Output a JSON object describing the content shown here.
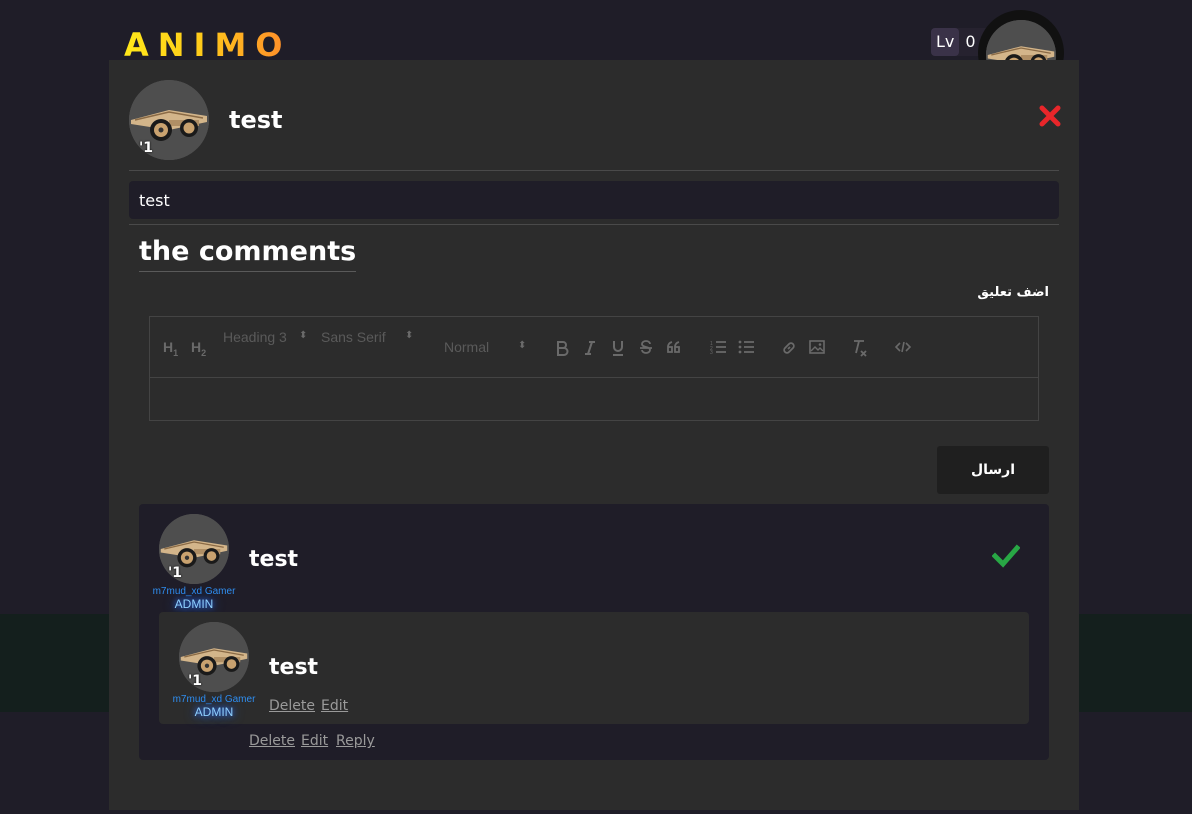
{
  "header": {
    "logo": "ANIMO",
    "level_label": "Lv",
    "level_value": "0"
  },
  "post": {
    "title": "test",
    "avatar_badge": "'1",
    "body": "test"
  },
  "comments_section": {
    "title": "the comments",
    "add_comment_label": "اضف تعليق",
    "send_label": "ارسال"
  },
  "editor_toolbar": {
    "h1": "H1",
    "h2": "H2",
    "heading_select": "Heading 3",
    "font_select": "Sans Serif",
    "size_select": "Normal"
  },
  "comments": [
    {
      "text": "test",
      "username": "m7mud_xd Gamer",
      "role": "ADMIN",
      "avatar_badge": "'1",
      "actions": [
        "Delete",
        "Edit",
        "Reply"
      ],
      "reply": {
        "text": "test",
        "username": "m7mud_xd Gamer",
        "role": "ADMIN",
        "avatar_badge": "'1",
        "actions": [
          "Delete",
          "Edit"
        ]
      }
    }
  ],
  "colors": {
    "close": "#e8262a",
    "check": "#28a745",
    "username": "#2f8ef0",
    "role_glow": "#2a6fff"
  },
  "icons": {
    "close": "close-icon",
    "check": "check-icon",
    "bold": "bold-icon",
    "italic": "italic-icon",
    "underline": "underline-icon",
    "strike": "strike-icon",
    "quote": "quote-icon",
    "ordered_list": "ordered-list-icon",
    "bullet_list": "bullet-list-icon",
    "link": "link-icon",
    "image": "image-icon",
    "clear_format": "clear-format-icon",
    "code": "code-icon"
  }
}
